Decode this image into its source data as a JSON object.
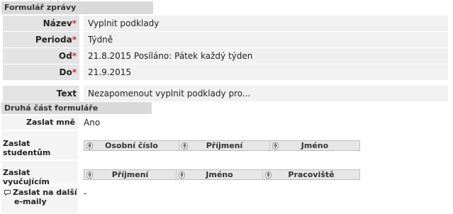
{
  "section1": {
    "title": "Formulář zprávy"
  },
  "fields": [
    {
      "label": "Název",
      "required": "*",
      "value": "Vyplnit podklady"
    },
    {
      "label": "Perioda",
      "required": "*",
      "value": "Týdně"
    },
    {
      "label": "Od",
      "required": "*",
      "value": "21.8.2015 Posíláno: Pátek každý týden"
    },
    {
      "label": "Do",
      "required": "*",
      "value": "21.9.2015"
    },
    {
      "label": "Text",
      "value": "Nezapomenout vyplnit podklady pro..."
    }
  ],
  "section2": {
    "title": "Druhá část formuláře"
  },
  "send_me": {
    "label": "Zaslat mně",
    "value": "Ano"
  },
  "send_students": {
    "label": "Zaslat studentům",
    "columns": [
      "Osobní číslo",
      "Příjmení",
      "Jméno"
    ]
  },
  "send_teachers": {
    "label": "Zaslat vyučujícím",
    "columns": [
      "Příjmení",
      "Jméno",
      "Pracoviště"
    ]
  },
  "send_emails": {
    "icon": "speech-bubble-icon",
    "label_line1": "Zaslat na další",
    "label_line2": "e-maily",
    "value": "-"
  },
  "colors": {
    "required": "#cc3333",
    "section_header_bg": "#d9d9d9",
    "label_bg": "#e3e3e3",
    "value_bg": "#f1f1f1"
  }
}
